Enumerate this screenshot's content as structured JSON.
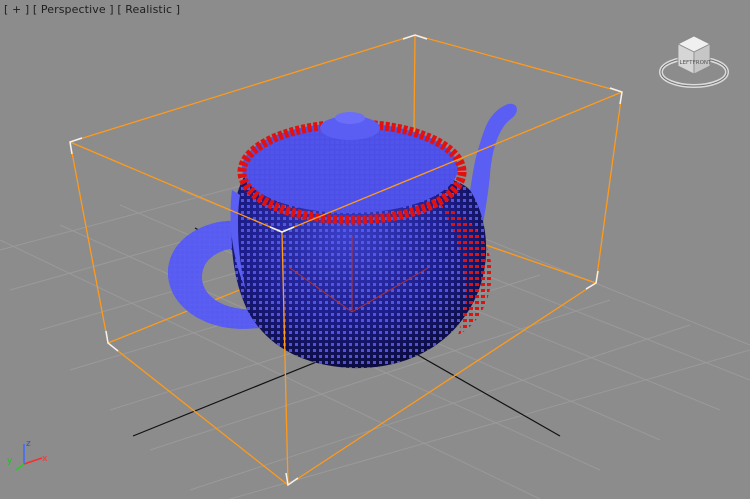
{
  "viewport": {
    "label_plus": "[ + ]",
    "label_view": "[ Perspective ]",
    "label_shading": "[ Realistic ]"
  },
  "viewcube": {
    "face_top": "",
    "face_left": "LEFT",
    "face_front": "FRONT"
  },
  "axis_gizmo": {
    "x": "x",
    "y": "y",
    "z": "z"
  },
  "colors": {
    "background": "#8c8c8c",
    "grid": "#9a9a9a",
    "bounding_box": "#ff9a1a",
    "particles_blue": "#5a5ef2",
    "particles_red": "#e31010",
    "teapot_body": "#1a1a80"
  },
  "icons": [
    "viewcube-icon",
    "axis-tripod-icon"
  ]
}
